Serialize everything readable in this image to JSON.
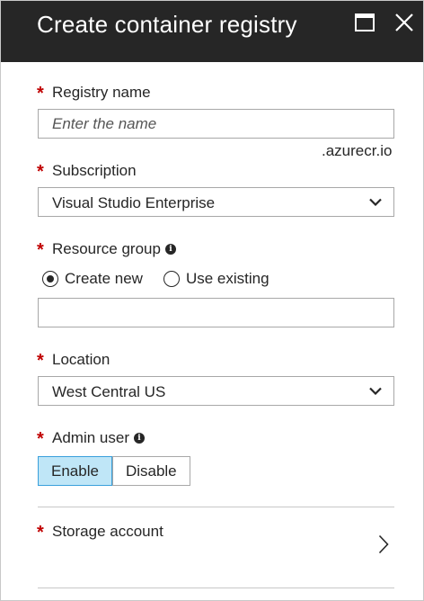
{
  "blade": {
    "title": "Create container registry"
  },
  "fields": {
    "registry_name": {
      "label": "Registry name",
      "placeholder": "Enter the name",
      "value": "",
      "suffix": ".azurecr.io"
    },
    "subscription": {
      "label": "Subscription",
      "selected": "Visual Studio Enterprise"
    },
    "resource_group": {
      "label": "Resource group",
      "options": [
        "Create new",
        "Use existing"
      ],
      "selected": "Create new",
      "value": ""
    },
    "location": {
      "label": "Location",
      "selected": "West Central US"
    },
    "admin_user": {
      "label": "Admin user",
      "options": [
        "Enable",
        "Disable"
      ],
      "selected": "Enable"
    },
    "storage_account": {
      "label": "Storage account"
    }
  },
  "icons": {
    "required": "*",
    "info": "i"
  },
  "colors": {
    "titlebar": "#262626",
    "required": "#c00000",
    "toggle_active_bg": "#bfe6f7",
    "toggle_active_border": "#3aa0dc"
  }
}
